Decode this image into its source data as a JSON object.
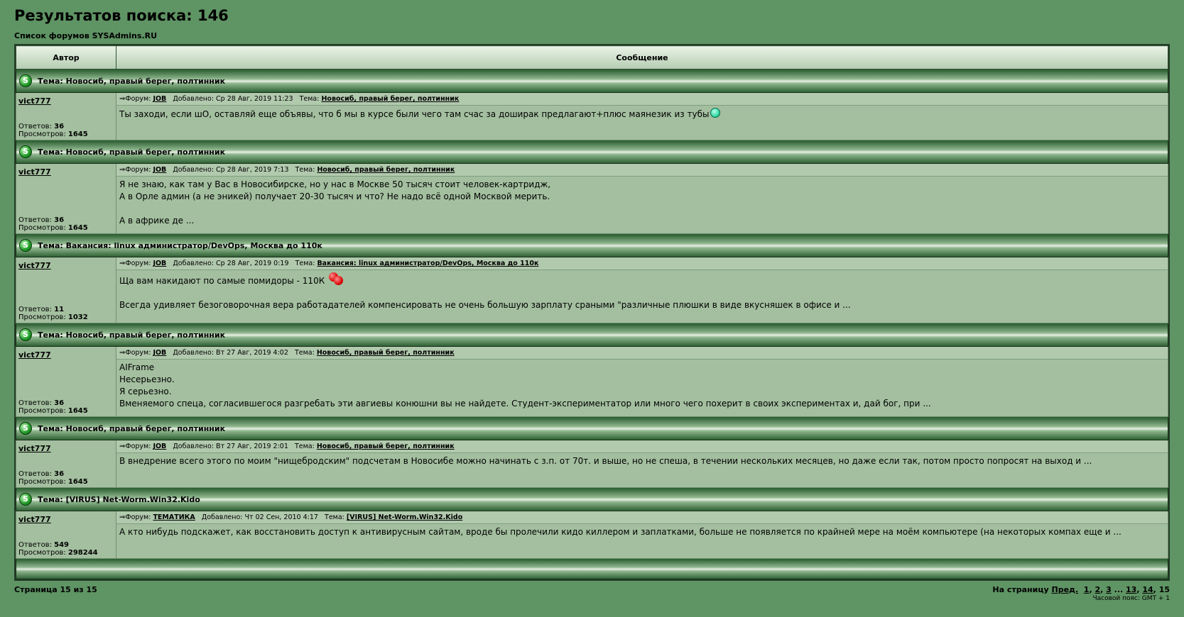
{
  "title": "Результатов поиска: 146",
  "forum_list_link": "Список форумов SYSAdmins.RU",
  "columns": {
    "author": "Автор",
    "message": "Сообщение"
  },
  "labels": {
    "topic_prefix": "Тема:",
    "forum": "Форум:",
    "added": "Добавлено:",
    "topic": "Тема:",
    "replies": "Ответов:",
    "views": "Просмотров:"
  },
  "posts": [
    {
      "topic": "Новосиб, правый берег, полтинник",
      "author": "vict777",
      "replies": "36",
      "views": "1645",
      "forum": "JOB",
      "date": "Ср 28 Авг, 2019 11:23",
      "lines": [
        "Ты заходи, если шО, оставляй еще объявы, что б мы в курсе были чего там счас за доширак предлагают+плюс маянезик из тубы"
      ],
      "emoticon": "smile-green"
    },
    {
      "topic": "Новосиб, правый берег, полтинник",
      "author": "vict777",
      "replies": "36",
      "views": "1645",
      "forum": "JOB",
      "date": "Ср 28 Авг, 2019 7:13",
      "lines": [
        "Я не знаю, как там у Вас в Новосибирске, но у нас в Москве 50 тысяч стоит человек-картридж,",
        "А в Орле админ (а не эникей) получает 20-30 тысяч и что? Не надо всё одной Москвой мерить.",
        "",
        "А в африке де ..."
      ]
    },
    {
      "topic": "Вакансия: linux администратор/DevOps, Москва до 110к",
      "author": "vict777",
      "replies": "11",
      "views": "1032",
      "forum": "JOB",
      "date": "Ср 28 Авг, 2019 0:19",
      "lines": [
        "Ща вам накидают по самые помидоры - 110К",
        "",
        "Всегда удивляет безоговорочная вера работадателей компенсировать не очень большую зарплату сраными \"различные плюшки в виде вкусняшек в офисе и ..."
      ],
      "emoticon": "tomatoes-red"
    },
    {
      "topic": "Новосиб, правый берег, полтинник",
      "author": "vict777",
      "replies": "36",
      "views": "1645",
      "forum": "JOB",
      "date": "Вт 27 Авг, 2019 4:02",
      "lines": [
        "AIFrame",
        "Несерьезно.",
        "Я серьезно.",
        "Вменяемого спеца, согласившегося разгребать эти авгиевы конюшни вы не найдете. Студент-экспериментатор или много чего похерит в своих экспериментах и, дай бог, при ..."
      ]
    },
    {
      "topic": "Новосиб, правый берег, полтинник",
      "author": "vict777",
      "replies": "36",
      "views": "1645",
      "forum": "JOB",
      "date": "Вт 27 Авг, 2019 2:01",
      "lines": [
        "В внедрение всего этого по моим \"нищебродским\" подсчетам в Новосибе можно начинать с з.п. от 70т. и выше, но не спеша, в течении нескольких месяцев, но даже если так, потом просто попросят на выход и ..."
      ]
    },
    {
      "topic": "[VIRUS] Net-Worm.Win32.Kido",
      "author": "vict777",
      "replies": "549",
      "views": "298244",
      "forum": "ТЕМАТИКА",
      "date": "Чт 02 Сен, 2010 4:17",
      "lines": [
        "А кто нибудь подскажет, как восстановить доступ к антивирусным сайтам, вроде бы пролечили кидо киллером и заплатками, больше не появляется по крайней мере на моём компьютере (на некоторых компах еще и ..."
      ]
    }
  ],
  "footer": {
    "page_count": "Страница 15 из 15",
    "goto_label": "На страницу",
    "prev": "Пред.",
    "pages": [
      "1",
      "2",
      "3",
      "...",
      "13",
      "14",
      "15"
    ],
    "timezone": "Часовой пояс: GMT + 1"
  }
}
